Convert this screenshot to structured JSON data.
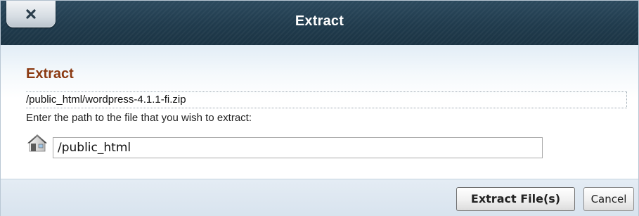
{
  "dialog": {
    "title": "Extract",
    "close_icon": "close-x-icon"
  },
  "content": {
    "heading": "Extract",
    "source_path": "/public_html/wordpress-4.1.1-fi.zip",
    "instruction": "Enter the path to the file that you wish to extract:",
    "home_icon": "home-icon",
    "destination_value": "/public_html"
  },
  "footer": {
    "extract_label": "Extract File(s)",
    "cancel_label": "Cancel"
  },
  "colors": {
    "titlebar": "#203b4d",
    "heading": "#8b3a12",
    "body_tint": "#e2edf6",
    "footer": "#d8e3ee"
  }
}
